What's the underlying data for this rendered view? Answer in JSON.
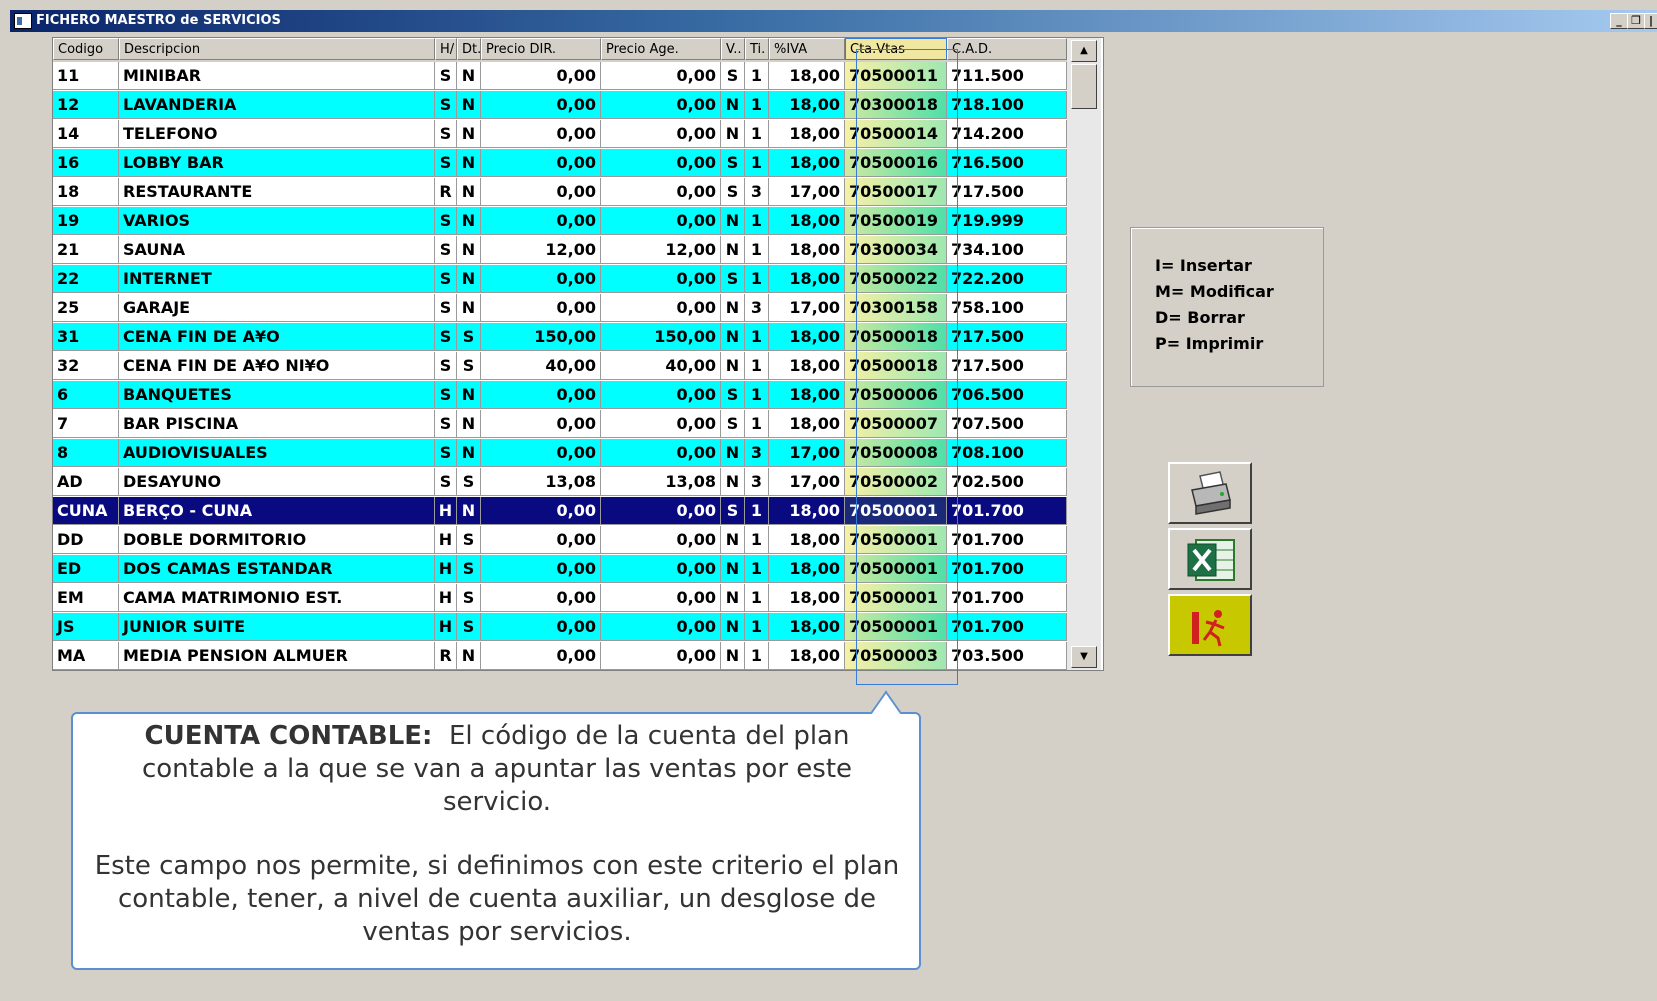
{
  "window": {
    "title": "FICHERO MAESTRO de SERVICIOS",
    "buttons": {
      "minimize": "_",
      "maximize": "❐",
      "close": "|"
    }
  },
  "grid": {
    "columns": [
      "Codigo",
      "Descripcion",
      "H/",
      "Dt.",
      "Precio DIR.",
      "Precio Age.",
      "V..",
      "Ti.",
      "%IVA",
      "Cta.Vtas",
      "C.A.D."
    ],
    "rows": [
      [
        "11",
        "MINIBAR",
        "S",
        "N",
        "0,00",
        "0,00",
        "S",
        "1",
        "18,00",
        "70500011",
        "711.500"
      ],
      [
        "12",
        "LAVANDERIA",
        "S",
        "N",
        "0,00",
        "0,00",
        "N",
        "1",
        "18,00",
        "70300018",
        "718.100"
      ],
      [
        "14",
        "TELEFONO",
        "S",
        "N",
        "0,00",
        "0,00",
        "N",
        "1",
        "18,00",
        "70500014",
        "714.200"
      ],
      [
        "16",
        "LOBBY BAR",
        "S",
        "N",
        "0,00",
        "0,00",
        "S",
        "1",
        "18,00",
        "70500016",
        "716.500"
      ],
      [
        "18",
        "RESTAURANTE",
        "R",
        "N",
        "0,00",
        "0,00",
        "S",
        "3",
        "17,00",
        "70500017",
        "717.500"
      ],
      [
        "19",
        "VARIOS",
        "S",
        "N",
        "0,00",
        "0,00",
        "N",
        "1",
        "18,00",
        "70500019",
        "719.999"
      ],
      [
        "21",
        "SAUNA",
        "S",
        "N",
        "12,00",
        "12,00",
        "N",
        "1",
        "18,00",
        "70300034",
        "734.100"
      ],
      [
        "22",
        "INTERNET",
        "S",
        "N",
        "0,00",
        "0,00",
        "S",
        "1",
        "18,00",
        "70500022",
        "722.200"
      ],
      [
        "25",
        "GARAJE",
        "S",
        "N",
        "0,00",
        "0,00",
        "N",
        "3",
        "17,00",
        "70300158",
        "758.100"
      ],
      [
        "31",
        "CENA FIN DE A¥O",
        "S",
        "S",
        "150,00",
        "150,00",
        "N",
        "1",
        "18,00",
        "70500018",
        "717.500"
      ],
      [
        "32",
        "CENA FIN DE A¥O NI¥O",
        "S",
        "S",
        "40,00",
        "40,00",
        "N",
        "1",
        "18,00",
        "70500018",
        "717.500"
      ],
      [
        "6",
        "BANQUETES",
        "S",
        "N",
        "0,00",
        "0,00",
        "S",
        "1",
        "18,00",
        "70500006",
        "706.500"
      ],
      [
        "7",
        "BAR PISCINA",
        "S",
        "N",
        "0,00",
        "0,00",
        "S",
        "1",
        "18,00",
        "70500007",
        "707.500"
      ],
      [
        "8",
        "AUDIOVISUALES",
        "S",
        "N",
        "0,00",
        "0,00",
        "N",
        "3",
        "17,00",
        "70500008",
        "708.100"
      ],
      [
        "AD",
        "DESAYUNO",
        "S",
        "S",
        "13,08",
        "13,08",
        "N",
        "3",
        "17,00",
        "70500002",
        "702.500"
      ],
      [
        "CUNA",
        "BERÇO - CUNA",
        "H",
        "N",
        "0,00",
        "0,00",
        "S",
        "1",
        "18,00",
        "70500001",
        "701.700"
      ],
      [
        "DD",
        "DOBLE DORMITORIO",
        "H",
        "S",
        "0,00",
        "0,00",
        "N",
        "1",
        "18,00",
        "70500001",
        "701.700"
      ],
      [
        "ED",
        "DOS CAMAS ESTANDAR",
        "H",
        "S",
        "0,00",
        "0,00",
        "N",
        "1",
        "18,00",
        "70500001",
        "701.700"
      ],
      [
        "EM",
        "CAMA MATRIMONIO EST.",
        "H",
        "S",
        "0,00",
        "0,00",
        "N",
        "1",
        "18,00",
        "70500001",
        "701.700"
      ],
      [
        "JS",
        "JUNIOR SUITE",
        "H",
        "S",
        "0,00",
        "0,00",
        "N",
        "1",
        "18,00",
        "70500001",
        "701.700"
      ],
      [
        "MA",
        "MEDIA PENSION ALMUER",
        "R",
        "N",
        "0,00",
        "0,00",
        "N",
        "1",
        "18,00",
        "70500003",
        "703.500"
      ]
    ],
    "selected_row_code": "CUNA",
    "highlighted_column": "Cta.Vtas",
    "scroll_up": "▲",
    "scroll_down": "▼"
  },
  "legend": {
    "lines": [
      "I= Insertar",
      "M= Modificar",
      "D= Borrar",
      "P= Imprimir"
    ]
  },
  "toolbar": {
    "buttons": [
      {
        "name": "print-button",
        "icon": "printer-icon"
      },
      {
        "name": "excel-button",
        "icon": "excel-icon"
      },
      {
        "name": "exit-button",
        "icon": "exit-icon"
      }
    ]
  },
  "callout": {
    "lead": "CUENTA  CONTABLE:",
    "text1": "El código de la cuenta del plan contable a la que  se  van a apuntar las ventas por este servicio.",
    "text2": "Este  campo  nos  permite,  si  definimos con  este  criterio  el plan  contable, tener,  a nivel de cuenta auxiliar, un desglose de ventas  por servicios."
  },
  "colors": {
    "alt_row": "#00ffff",
    "selected_row": "#0a0a80",
    "title_bar": "#0a246a",
    "callout_border": "#5b8fcf"
  }
}
